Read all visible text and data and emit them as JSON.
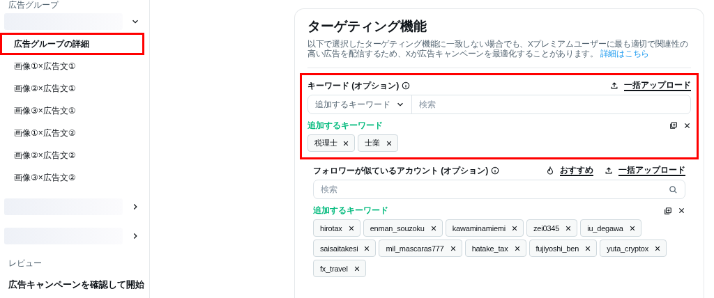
{
  "sidebar": {
    "section_label": "広告グループ",
    "groups": [
      {
        "expanded": true,
        "items": [
          {
            "label": "広告グループの詳細",
            "selected": true,
            "highlighted": true
          },
          {
            "label": "画像①×広告文①",
            "selected": false,
            "highlighted": false
          },
          {
            "label": "画像②×広告文①",
            "selected": false,
            "highlighted": false
          },
          {
            "label": "画像③×広告文①",
            "selected": false,
            "highlighted": false
          },
          {
            "label": "画像①×広告文②",
            "selected": false,
            "highlighted": false
          },
          {
            "label": "画像②×広告文②",
            "selected": false,
            "highlighted": false
          },
          {
            "label": "画像③×広告文②",
            "selected": false,
            "highlighted": false
          }
        ]
      },
      {
        "expanded": false
      },
      {
        "expanded": false
      }
    ],
    "review_label": "レビュー",
    "review_item": "広告キャンペーンを確認して開始"
  },
  "main": {
    "title": "ターゲティング機能",
    "description": "以下で選択したターゲティング機能に一致しない場合でも、Xプレミアムユーザーに最も適切で関連性の高い広告を配信するため、Xが広告キャンペーンを最適化することがあります。",
    "link": "詳細はこちら",
    "sections": [
      {
        "kind": "keyword",
        "label": "キーワード (オプション)",
        "highlighted": true,
        "actions": [
          {
            "kind": "upload",
            "label": "一括アップロード"
          }
        ],
        "dropdown": {
          "value": "追加するキーワード"
        },
        "search": {
          "placeholder": "検索"
        },
        "added_label": "追加するキーワード",
        "chips": [
          "税理士",
          "士業"
        ]
      },
      {
        "kind": "account",
        "label": "フォロワーが似ているアカウント (オプション)",
        "highlighted": false,
        "actions": [
          {
            "kind": "recommend",
            "label": "おすすめ"
          },
          {
            "kind": "upload",
            "label": "一括アップロード"
          }
        ],
        "search": {
          "placeholder": "検索"
        },
        "added_label": "追加するキーワード",
        "chips": [
          "hirotax",
          "enman_souzoku",
          "kawaminamiemi",
          "zei0345",
          "iu_degawa",
          "saisaitakesi",
          "mil_mascaras777",
          "hatake_tax",
          "fujiyoshi_ben",
          "yuta_cryptox",
          "fx_travel"
        ]
      }
    ]
  }
}
